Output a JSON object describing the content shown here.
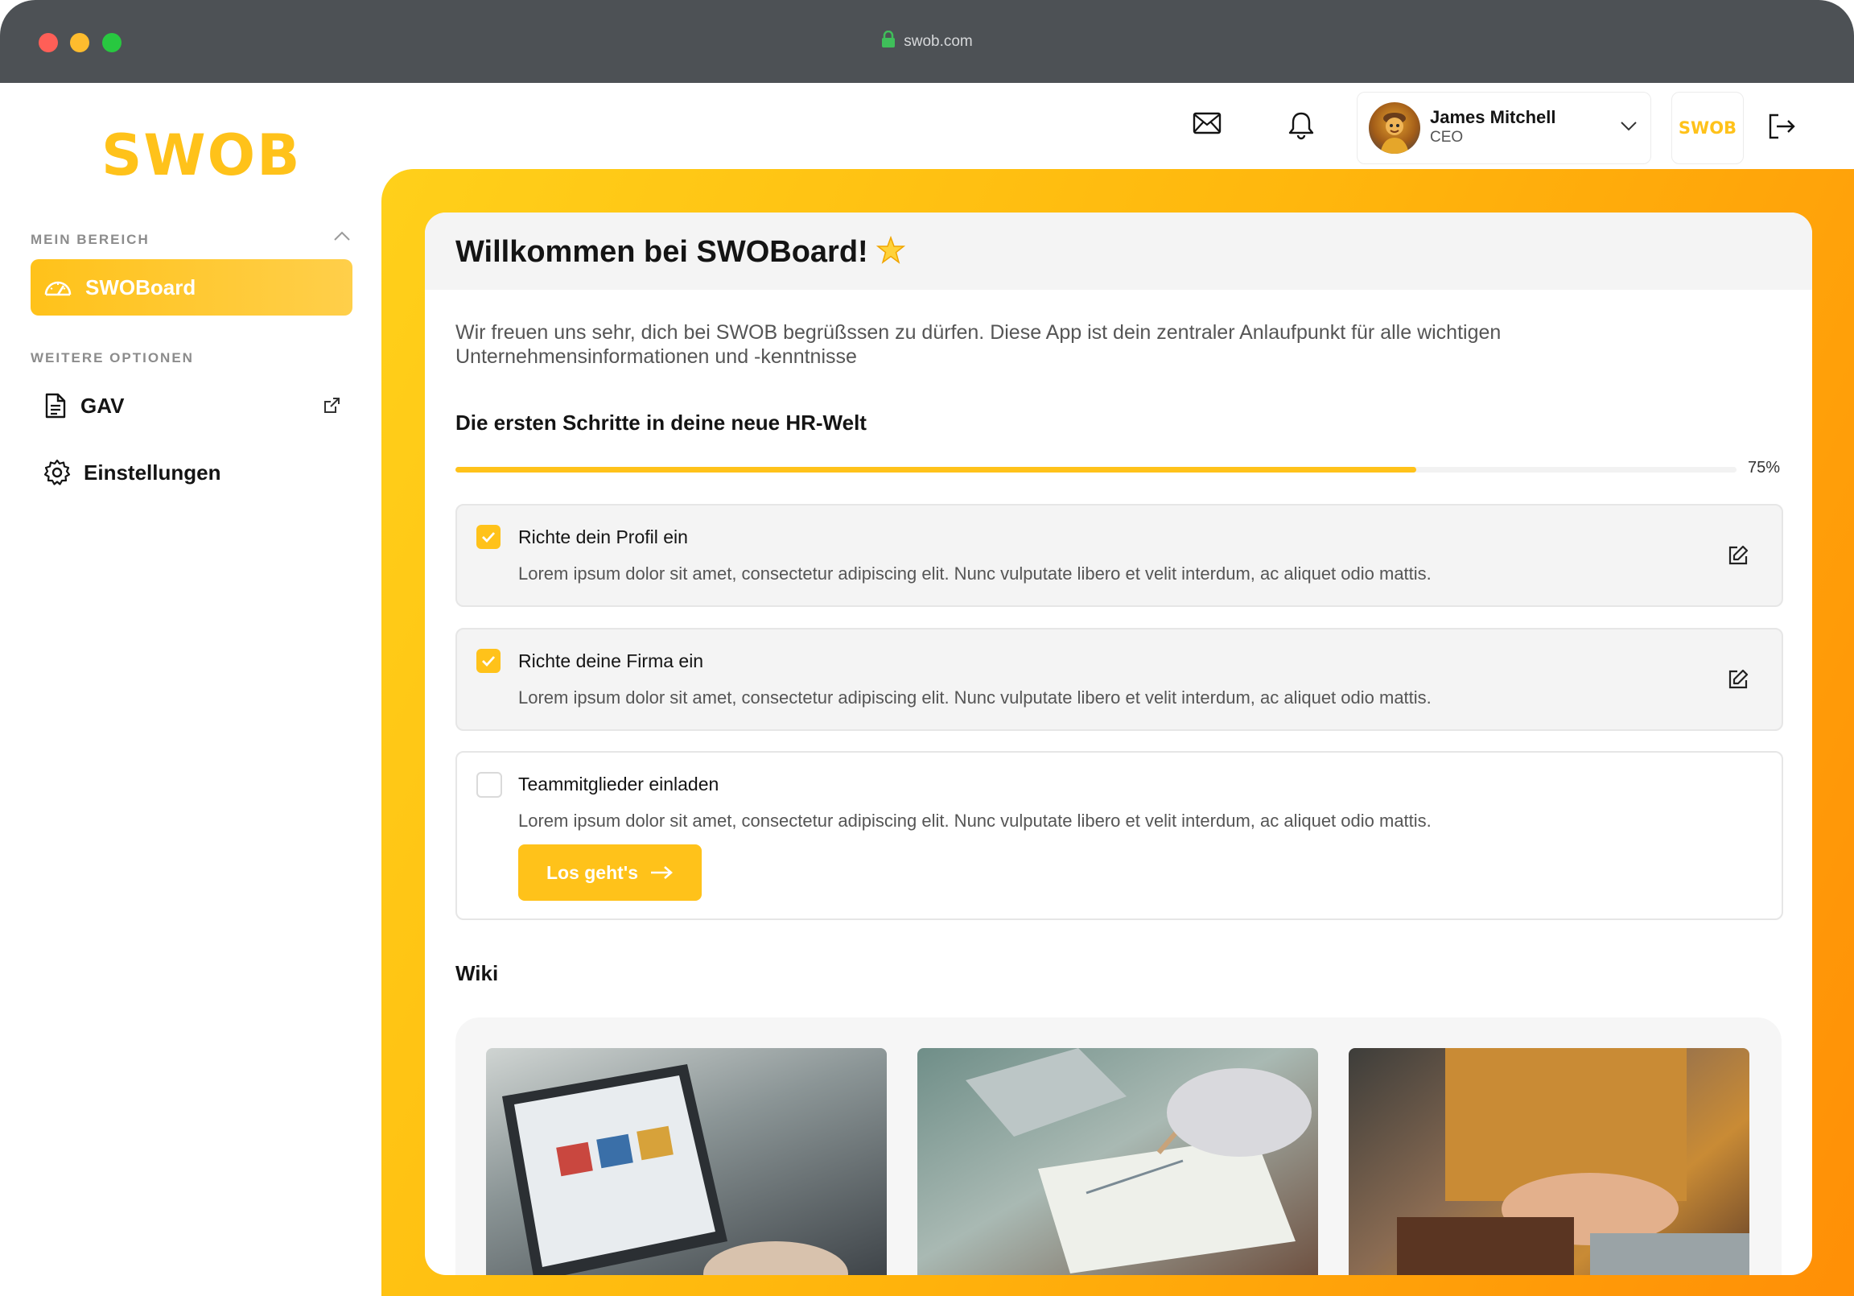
{
  "browser": {
    "url": "swob.com"
  },
  "sidebar": {
    "logo": "SWOB",
    "section1_label": "MEIN BEREICH",
    "active_item": {
      "label": "SWOBoard",
      "icon": "dashboard-gauge-icon"
    },
    "section2_label": "WEITERE OPTIONEN",
    "items": [
      {
        "label": "GAV",
        "icon": "document-icon",
        "external": true
      },
      {
        "label": "Einstellungen",
        "icon": "gear-icon"
      }
    ]
  },
  "header": {
    "user": {
      "name": "James Mitchell",
      "role": "CEO"
    },
    "badge": "SWOB"
  },
  "main": {
    "title": "Willkommen bei SWOBoard!",
    "intro": "Wir freuen uns sehr, dich bei SWOB begrüßssen zu dürfen. Diese App ist dein zentraler Anlaufpunkt für alle wichtigen Unternehmensinformationen und -kenntnisse",
    "steps_title": "Die ersten Schritte in deine neue HR-Welt",
    "progress": {
      "value": 0.75,
      "label": "75%"
    },
    "tasks": [
      {
        "title": "Richte dein Profil ein",
        "desc": "Lorem ipsum dolor sit amet, consectetur adipiscing elit. Nunc vulputate libero et velit interdum, ac aliquet odio mattis.",
        "done": true
      },
      {
        "title": "Richte deine Firma ein",
        "desc": "Lorem ipsum dolor sit amet, consectetur adipiscing elit. Nunc vulputate libero et velit interdum, ac aliquet odio mattis.",
        "done": true
      },
      {
        "title": "Teammitglieder einladen",
        "desc": "Lorem ipsum dolor sit amet, consectetur adipiscing elit. Nunc vulputate libero et velit interdum, ac aliquet odio mattis.",
        "done": false,
        "button": "Los geht's"
      }
    ],
    "wiki_title": "Wiki"
  },
  "colors": {
    "accent": "#ffc21a",
    "gradient_end": "#ff8d06"
  }
}
